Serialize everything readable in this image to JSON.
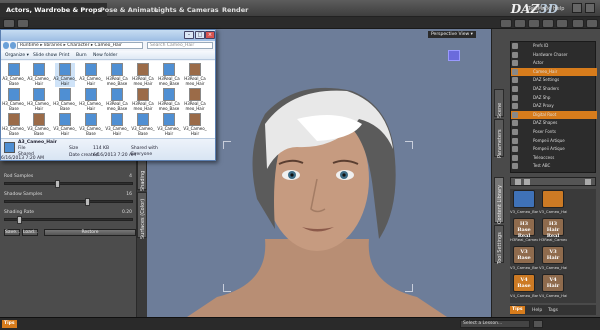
{
  "app": {
    "main_tabs": [
      "Actors, Wardrobe & Props",
      "Pose & Animate",
      "Lights & Cameras",
      "Render"
    ],
    "brand_a": "DAZ",
    "brand_b": "3D",
    "top_links": [
      "TeleMark",
      "Help"
    ]
  },
  "left_panel": {
    "slider1_label": "Rod Samples",
    "slider1_value": "4",
    "slider2_label": "Shadow Samples",
    "slider2_value": "16",
    "slider3_label": "Shading Rate",
    "slider3_value": "0.20",
    "buttons": [
      "Save...",
      "Load...",
      "Restore"
    ],
    "tabs": [
      "Shading",
      "Surfaces (Color)"
    ]
  },
  "explorer": {
    "address": "Runtime ▸ libraries ▸ Character ▸ Cameo_Hair",
    "search_placeholder": "Search Cameo_Hair",
    "toolbar": [
      "Organize ▾",
      "Slide show",
      "Print",
      "Burn",
      "New folder"
    ],
    "files": [
      {
        "name": "A3_Cameo_Base",
        "kind": "blue"
      },
      {
        "name": "A3_Cameo_Hair",
        "kind": "blue"
      },
      {
        "name": "A3_Cameo_Hair",
        "kind": "blue"
      },
      {
        "name": "A3_Cameo_Hair",
        "kind": "blue"
      },
      {
        "name": "H3Real_Cameo_Base",
        "kind": "blue"
      },
      {
        "name": "H3Real_Cameo_Hair",
        "kind": "brown"
      },
      {
        "name": "H3Real_Cameo_Base",
        "kind": "blue"
      },
      {
        "name": "H3Real_Cameo_Hair",
        "kind": "brown"
      },
      {
        "name": "H3_Cameo_Base",
        "kind": "blue"
      },
      {
        "name": "H3_Cameo_Hair",
        "kind": "blue"
      },
      {
        "name": "H3_Cameo_Base",
        "kind": "blue"
      },
      {
        "name": "H3_Cameo_Hair",
        "kind": "blue"
      },
      {
        "name": "H3Real_Cameo_Base",
        "kind": "blue"
      },
      {
        "name": "H3Real_Cameo_Hair",
        "kind": "brown"
      },
      {
        "name": "H3Real_Cameo_Base",
        "kind": "blue"
      },
      {
        "name": "H3Real_Cameo_Hair",
        "kind": "brown"
      },
      {
        "name": "H3_Cameo_Base",
        "kind": "brown"
      },
      {
        "name": "V3_Cameo_Base",
        "kind": "brown"
      },
      {
        "name": "V3_Cameo_Hair",
        "kind": "blue"
      },
      {
        "name": "V3_Cameo_Base",
        "kind": "blue"
      },
      {
        "name": "V3_Cameo_Hair",
        "kind": "blue"
      },
      {
        "name": "V3_Cameo_Base",
        "kind": "blue"
      },
      {
        "name": "V3_Cameo_Hair",
        "kind": "blue"
      },
      {
        "name": "V3_Cameo_Hair",
        "kind": "brown"
      }
    ],
    "details": {
      "name_label": "A3_Cameo_Hair",
      "type": "File",
      "state": "Shared",
      "modified": "6/16/2013 7:20 AM",
      "size_label": "Size",
      "size": "114 KB",
      "created_label": "Date created",
      "created": "6/16/2013 7:20 AM",
      "shared_label": "Shared with",
      "shared": "Everyone"
    }
  },
  "viewport": {
    "camera_label": "Perspective View ▾"
  },
  "right_panel": {
    "side_tabs": [
      "Scene",
      "Parameters",
      "Content Library",
      "Tool Settings"
    ],
    "scene_items": [
      {
        "label": "Prefs ID",
        "highlight": false
      },
      {
        "label": "Hardware Chaser",
        "highlight": false
      },
      {
        "label": "Actor",
        "highlight": false
      },
      {
        "label": "Cameo_Hair",
        "highlight": true
      },
      {
        "label": "DAZ Settings",
        "highlight": false
      },
      {
        "label": "DAZ Shaders",
        "highlight": false
      },
      {
        "label": "DAZ Shp",
        "highlight": false
      },
      {
        "label": "DAZ Proxy",
        "highlight": false
      },
      {
        "label": "Digital Root",
        "highlight": true
      },
      {
        "label": "DAZ Shapes",
        "highlight": false
      },
      {
        "label": "Poser Fonts",
        "highlight": false
      },
      {
        "label": "Pompeii Artique",
        "highlight": false
      },
      {
        "label": "Pompeii Artique",
        "highlight": false
      },
      {
        "label": "Teleaccess",
        "highlight": false
      },
      {
        "label": "Test ABC",
        "highlight": false
      }
    ],
    "content_tiles": [
      {
        "label": "V3_Cameo_Base",
        "text": "",
        "color": "#3f72b8"
      },
      {
        "label": "V3_Cameo_Hair",
        "text": "",
        "color": "#cc7a24"
      },
      {
        "label": "H3Real_Cameo_Base",
        "text": "H3 Base Real",
        "color": "#8f6b4d"
      },
      {
        "label": "H3Real_Cameo_Hair",
        "text": "H3 Hair Real",
        "color": "#8f6b4d"
      },
      {
        "label": "V3_Cameo_Base",
        "text": "V3 Base",
        "color": "#8f6b4d"
      },
      {
        "label": "V3_Cameo_Hair",
        "text": "V3 Hair",
        "color": "#8f6b4d"
      },
      {
        "label": "V4_Cameo_Base",
        "text": "V4 Base",
        "color": "#cc7a24"
      },
      {
        "label": "V4_Cameo_Hair",
        "text": "V4 Hair",
        "color": "#8f6b4d"
      }
    ],
    "bottom_labels": [
      "Tips",
      "Help",
      "Tags"
    ]
  },
  "bottom": {
    "tips": "Tips",
    "lesson": "Select a Lesson...",
    "accent": "#d77c1c"
  }
}
